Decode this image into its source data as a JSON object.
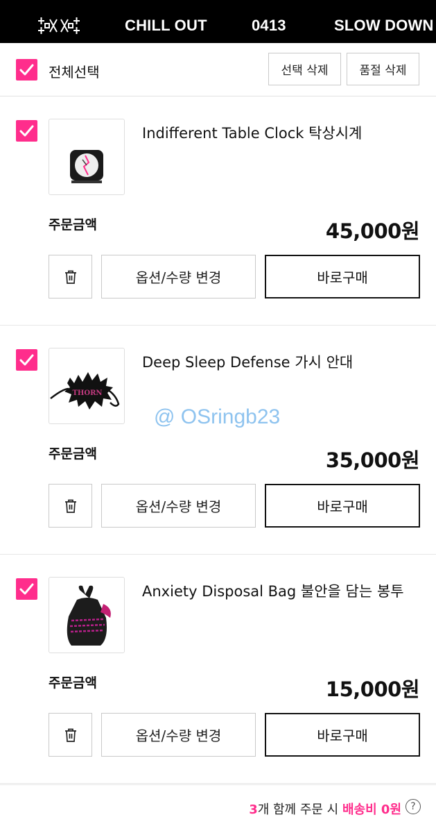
{
  "banner": {
    "logo_icon": "crossed-logo-icon",
    "ticker": [
      "CHILL OUT",
      "0413",
      "SLOW DOWN"
    ]
  },
  "cart": {
    "select_all_label": "전체선택",
    "select_all_checked": true,
    "delete_selected_label": "선택 삭제",
    "delete_soldout_label": "품절 삭제",
    "price_label": "주문금액",
    "option_label": "옵션/수량 변경",
    "buy_label": "바로구매",
    "items": [
      {
        "title": "Indifferent Table Clock 탁상시계",
        "price": "45,000원",
        "checked": true,
        "thumb_icon": "table-clock-image"
      },
      {
        "title": "Deep Sleep Defense 가시 안대",
        "price": "35,000원",
        "checked": true,
        "thumb_icon": "spiky-eye-mask-image",
        "thumb_text": "THORN"
      },
      {
        "title": "Anxiety Disposal Bag 불안을 담는 봉투",
        "price": "15,000원",
        "checked": true,
        "thumb_icon": "black-bag-image"
      }
    ]
  },
  "watermark": "@ OSringb23",
  "shipping": {
    "count": "3",
    "text_mid": "개 함께 주문 시 ",
    "highlight": "배송비 0원",
    "help": "?"
  },
  "colors": {
    "accent": "#ff2d8c",
    "banner_bg": "#000000",
    "watermark": "#8ec3ef"
  }
}
